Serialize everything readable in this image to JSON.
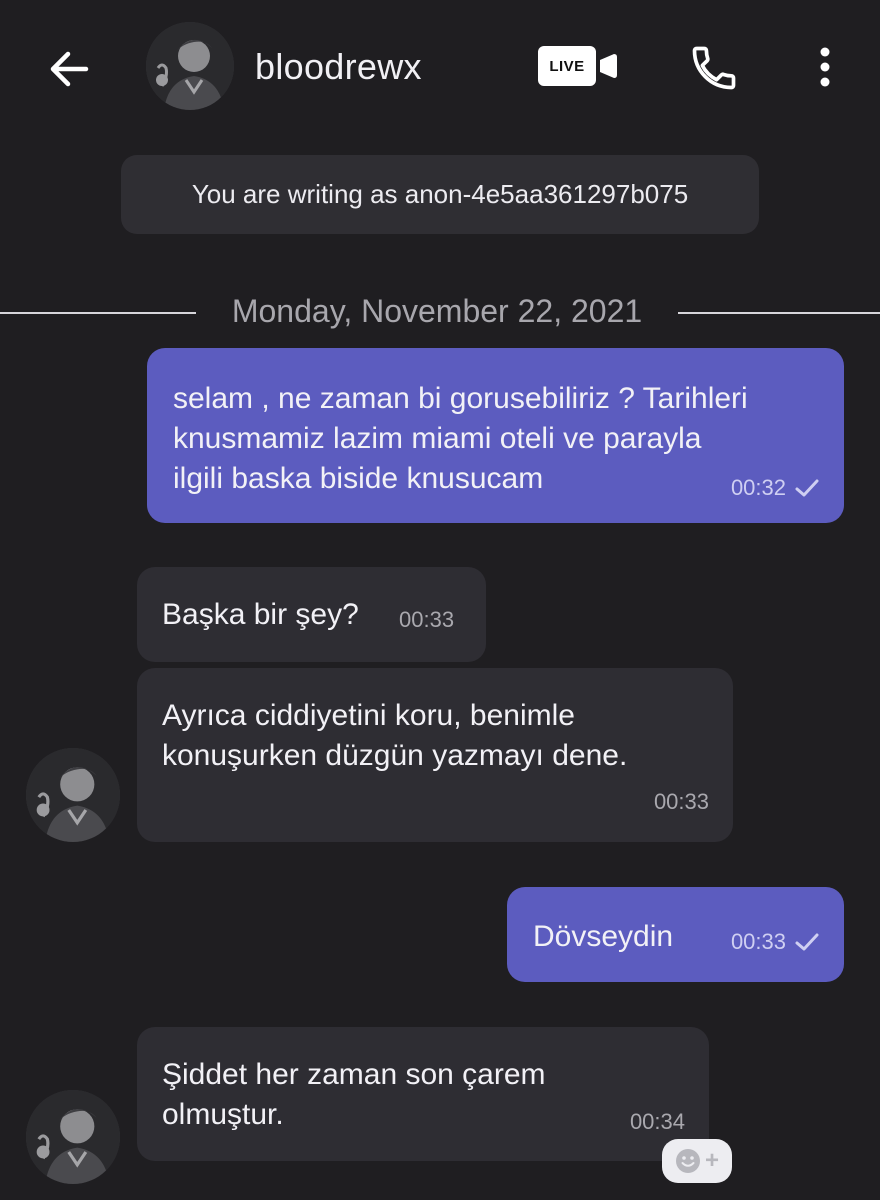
{
  "header": {
    "username": "bloodrewx",
    "live_label": "LIVE",
    "icons": {
      "back": "arrow-left-icon",
      "live": "live-video-icon",
      "call": "phone-icon",
      "more": "more-vertical-icon"
    }
  },
  "notice": "You are writing as anon-4e5aa361297b075",
  "date_separator": "Monday, November 22, 2021",
  "messages": [
    {
      "direction": "out",
      "text": "selam , ne zaman bi gorusebiliriz ? Tarihleri knusmamiz lazim miami oteli ve parayla ilgili baska biside knusucam",
      "time": "00:32",
      "read_receipt": true
    },
    {
      "direction": "in",
      "text": "Başka bir şey?",
      "time": "00:33"
    },
    {
      "direction": "in",
      "text": "Ayrıca ciddiyetini koru, benimle konuşurken düzgün yazmayı dene.",
      "time": "00:33"
    },
    {
      "direction": "out",
      "text": "Dövseydin",
      "time": "00:33",
      "read_receipt": true
    },
    {
      "direction": "in",
      "text": "Şiddet her zaman son çarem olmuştur.",
      "time": "00:34"
    }
  ],
  "reaction_button": {
    "icon": "smiley-add-icon",
    "plus": "+"
  },
  "colors": {
    "background": "#1f1e21",
    "outgoing_bubble": "#5c5cbf",
    "incoming_bubble": "#2e2d33",
    "notice_bg": "#2f2e33"
  }
}
